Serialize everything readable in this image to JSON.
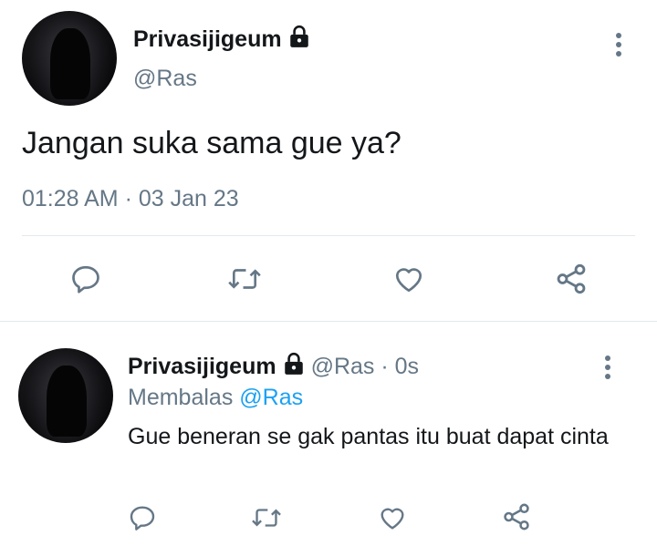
{
  "tweet": {
    "author_name": "Privasijigeum",
    "author_handle": "@Ras",
    "text": "Jangan suka sama gue ya?",
    "timestamp": "01:28 AM · 03 Jan 23",
    "protected_icon": "lock-icon",
    "actions": [
      "reply-icon",
      "retweet-icon",
      "like-icon",
      "share-icon"
    ]
  },
  "reply": {
    "author_name": "Privasijigeum",
    "author_handle_time": "@Ras · 0s",
    "replying_label": "Membalas",
    "replying_to": "@Ras",
    "text": "Gue beneran se gak pantas itu buat dapat cinta",
    "protected_icon": "lock-icon",
    "actions": [
      "reply-icon",
      "retweet-icon",
      "like-icon",
      "share-icon"
    ]
  },
  "colors": {
    "text": "#14171a",
    "secondary": "#657786",
    "link": "#1da1f2",
    "divider": "#e1e8ed"
  }
}
